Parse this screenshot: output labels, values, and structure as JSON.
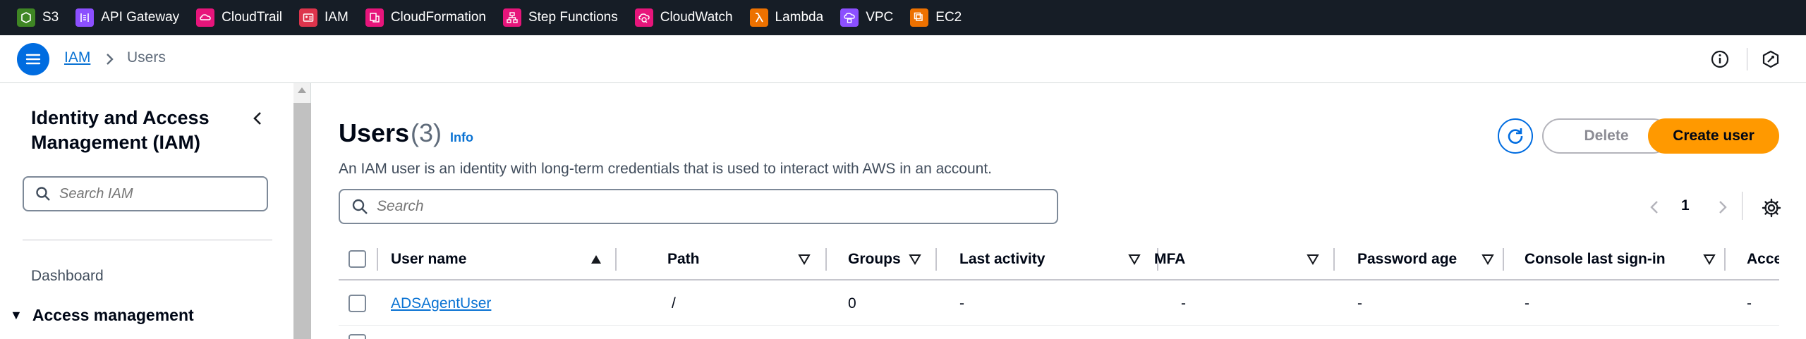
{
  "favorites": [
    {
      "label": "S3",
      "icon": "s3-icon",
      "color": "#3f8624"
    },
    {
      "label": "API Gateway",
      "icon": "api-gateway-icon",
      "color": "#8c4fff"
    },
    {
      "label": "CloudTrail",
      "icon": "cloudtrail-icon",
      "color": "#e7157b"
    },
    {
      "label": "IAM",
      "icon": "iam-icon",
      "color": "#dd344c"
    },
    {
      "label": "CloudFormation",
      "icon": "cloudformation-icon",
      "color": "#e7157b"
    },
    {
      "label": "Step Functions",
      "icon": "step-functions-icon",
      "color": "#e7157b"
    },
    {
      "label": "CloudWatch",
      "icon": "cloudwatch-icon",
      "color": "#e7157b"
    },
    {
      "label": "Lambda",
      "icon": "lambda-icon",
      "color": "#ed7100"
    },
    {
      "label": "VPC",
      "icon": "vpc-icon",
      "color": "#8c4fff"
    },
    {
      "label": "EC2",
      "icon": "ec2-icon",
      "color": "#ed7100"
    }
  ],
  "breadcrumb": {
    "root": "IAM",
    "current": "Users"
  },
  "sidebar": {
    "title": "Identity and Access Management (IAM)",
    "search_placeholder": "Search IAM",
    "dashboard": "Dashboard",
    "section": "Access management"
  },
  "page": {
    "title": "Users",
    "count": "(3)",
    "info": "Info",
    "description": "An IAM user is an identity with long-term credentials that is used to interact with AWS in an account.",
    "search_placeholder": "Search",
    "delete_label": "Delete",
    "create_label": "Create user",
    "current_page": "1"
  },
  "table": {
    "columns": [
      "User name",
      "Path",
      "Groups",
      "Last activity",
      "MFA",
      "Password age",
      "Console last sign-in",
      "Access key ID"
    ],
    "rows": [
      {
        "user_name": "ADSAgentUser",
        "path": "/",
        "groups": "0",
        "last_activity": "-",
        "mfa": "-",
        "password_age": "-",
        "console_last_signin": "-",
        "access_key_id": "-"
      }
    ]
  },
  "colors": {
    "accent": "#006ce0",
    "primary_button": "#ff9900",
    "topbar": "#161d26",
    "link": "#0972d3"
  }
}
